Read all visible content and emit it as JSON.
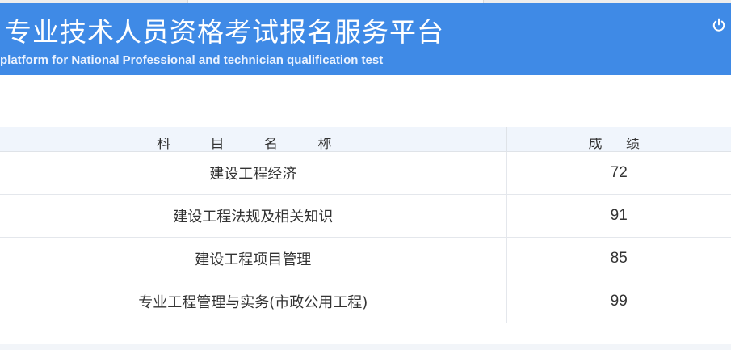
{
  "header": {
    "title": "专业技术人员资格考试报名服务平台",
    "subtitle": "platform for National Professional and technician qualification test",
    "power_icon": "power-icon"
  },
  "table": {
    "columns": [
      "科 目 名 称",
      "成 绩"
    ],
    "rows": [
      {
        "subject": "建设工程经济",
        "score": "72"
      },
      {
        "subject": "建设工程法规及相关知识",
        "score": "91"
      },
      {
        "subject": "建设工程项目管理",
        "score": "85"
      },
      {
        "subject": "专业工程管理与实务(市政公用工程)",
        "score": "99"
      }
    ]
  },
  "colors": {
    "banner": "#3f8ae6",
    "header_row": "#f0f5fc",
    "text": "#333333"
  }
}
